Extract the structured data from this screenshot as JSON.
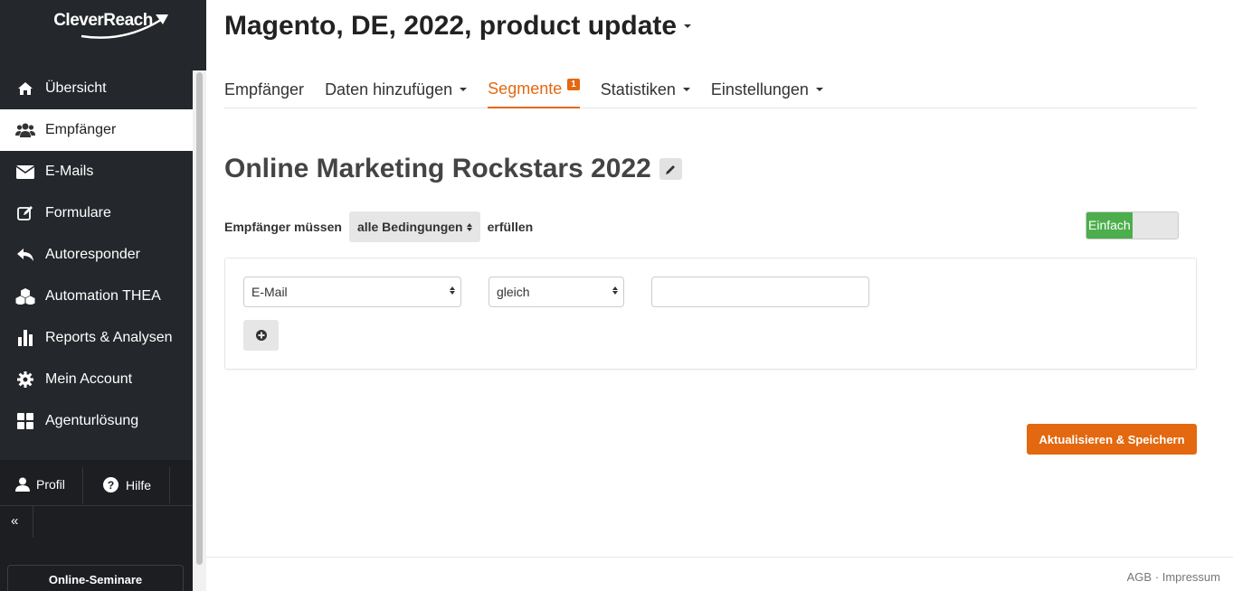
{
  "brand": {
    "logo_text": "CleverReach"
  },
  "sidebar": {
    "items": [
      {
        "label": "Übersicht",
        "icon": "home-icon"
      },
      {
        "label": "Empfänger",
        "icon": "users-icon",
        "active": true
      },
      {
        "label": "E-Mails",
        "icon": "envelope-icon"
      },
      {
        "label": "Formulare",
        "icon": "edit-icon"
      },
      {
        "label": "Autoresponder",
        "icon": "reply-icon"
      },
      {
        "label": "Automation THEA",
        "icon": "cubes-icon"
      },
      {
        "label": "Reports & Analysen",
        "icon": "bar-chart-icon"
      },
      {
        "label": "Mein Account",
        "icon": "gear-icon"
      },
      {
        "label": "Agenturlösung",
        "icon": "grid-icon"
      }
    ],
    "profile_label": "Profil",
    "help_label": "Hilfe",
    "collapse_label": "«",
    "seminar_label": "Online-Seminare"
  },
  "header": {
    "title": "Magento, DE, 2022, product update"
  },
  "tabs": [
    {
      "label": "Empfänger",
      "dropdown": false
    },
    {
      "label": "Daten hinzufügen",
      "dropdown": true
    },
    {
      "label": "Segmente",
      "dropdown": false,
      "active": true,
      "badge": "1"
    },
    {
      "label": "Statistiken",
      "dropdown": true
    },
    {
      "label": "Einstellungen",
      "dropdown": true
    }
  ],
  "segment": {
    "title": "Online Marketing Rockstars 2022",
    "condition_prefix": "Empfänger müssen",
    "condition_select": "alle Bedingungen",
    "condition_suffix": "erfüllen",
    "mode_toggle": "Einfach"
  },
  "rule": {
    "field_select": "E-Mail",
    "operator_select": "gleich",
    "value": ""
  },
  "actions": {
    "save_label": "Aktualisieren & Speichern"
  },
  "footer": {
    "agb": "AGB",
    "separator": "·",
    "impressum": "Impressum"
  },
  "colors": {
    "accent": "#e3680f",
    "sidebar_bg": "#24272b",
    "toggle_on": "#4cae4c"
  }
}
